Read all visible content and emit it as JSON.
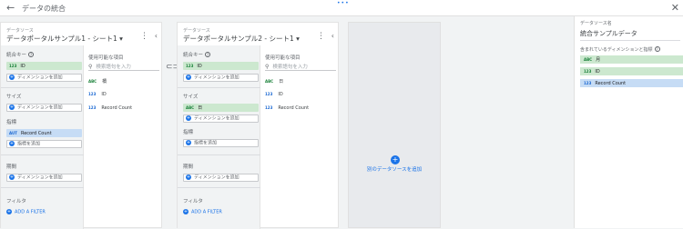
{
  "header": {
    "title": "データの統合",
    "back_icon": "arrow-left-icon",
    "close_icon": "close-icon"
  },
  "sources": [
    {
      "label": "データソース",
      "name": "データポータルサンプル1 - シート1 ▾",
      "join_key_title": "統合キー",
      "join_keys": [
        {
          "type": "123",
          "name": "ID"
        }
      ],
      "add_dimension": "ディメンションを追加",
      "dimensions_title": "サイズ",
      "dimensions": [],
      "metrics_title": "指標",
      "metrics": [
        {
          "type": "AUT",
          "name": "Record Count"
        }
      ],
      "add_metric": "指標を追加",
      "date_range_title": "期間",
      "filter_title": "フィルタ",
      "add_filter": "ADD A FILTER",
      "available_title": "使用可能な項目",
      "search_placeholder": "検索語句を入力",
      "available_fields": [
        {
          "type": "ABC",
          "name": "橋"
        },
        {
          "type": "123",
          "name": "ID"
        },
        {
          "type": "123",
          "name": "Record Count"
        }
      ]
    },
    {
      "label": "データソース",
      "name": "データポータルサンプル2 - シート1 ▾",
      "join_key_title": "統合キー",
      "join_keys": [
        {
          "type": "123",
          "name": "ID"
        }
      ],
      "add_dimension": "ディメンションを追加",
      "dimensions_title": "サイズ",
      "dimensions": [
        {
          "type": "ABC",
          "name": "日"
        }
      ],
      "metrics_title": "指標",
      "metrics": [],
      "add_metric": "指標を追加",
      "date_range_title": "期間",
      "filter_title": "フィルタ",
      "add_filter": "ADD A FILTER",
      "available_title": "使用可能な項目",
      "search_placeholder": "検索語句を入力",
      "available_fields": [
        {
          "type": "ABC",
          "name": "日"
        },
        {
          "type": "123",
          "name": "ID"
        },
        {
          "type": "123",
          "name": "Record Count"
        }
      ]
    }
  ],
  "add_source": {
    "label": "別のデータソースを追加"
  },
  "panel": {
    "name_label": "データソース名",
    "name_value": "統合サンプルデータ",
    "included_title": "含まれているディメンションと指標",
    "items": [
      {
        "type": "ABC",
        "name": "月",
        "color": "green"
      },
      {
        "type": "123",
        "name": "ID",
        "color": "green"
      },
      {
        "type": "123",
        "name": "Record Count",
        "color": "blue"
      }
    ]
  },
  "colors": {
    "accent": "#1a73e8",
    "dimension": "#cce8cf",
    "metric": "#c6dcf5"
  }
}
